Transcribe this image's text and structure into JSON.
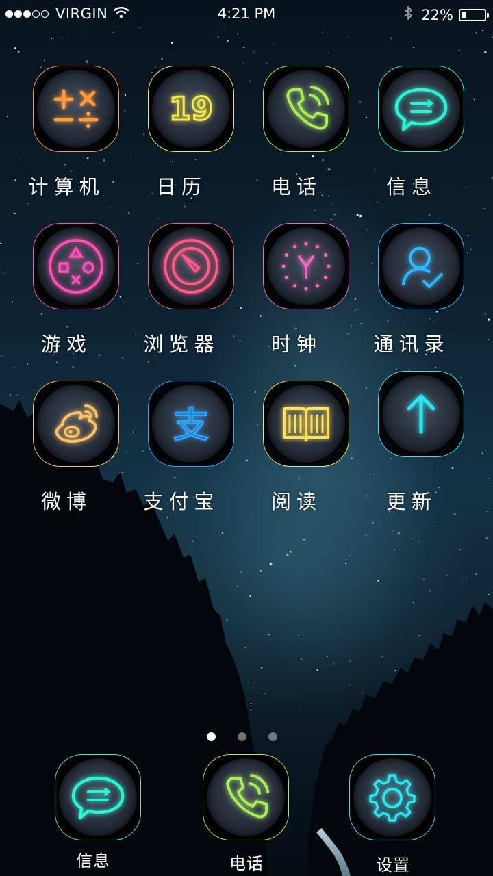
{
  "status_bar": {
    "carrier": "VIRGIN",
    "time": "4:21 PM",
    "battery_text": "22%",
    "battery_level": 0.22,
    "signal_bars": 5,
    "signal_filled": 3,
    "icons": [
      "wifi-icon",
      "bluetooth-icon",
      "battery-icon"
    ]
  },
  "apps": [
    {
      "label": "计算机",
      "icon": "calculator-icon",
      "color": "#ff9a3c"
    },
    {
      "label": "日历",
      "icon": "calendar-icon",
      "color": "#f6ea4a",
      "icon_text": "19"
    },
    {
      "label": "电话",
      "icon": "phone-icon",
      "color": "#a8ee5a"
    },
    {
      "label": "信息",
      "icon": "message-icon",
      "color": "#2ef2d4"
    },
    {
      "label": "游戏",
      "icon": "gamepad-icon",
      "color": "#ff4fb4"
    },
    {
      "label": "浏览器",
      "icon": "browser-compass-icon",
      "color": "#ff5a86"
    },
    {
      "label": "时钟",
      "icon": "clock-icon",
      "color": "#ee6ac0"
    },
    {
      "label": "通讯录",
      "icon": "contacts-icon",
      "color": "#2eb8ff"
    },
    {
      "label": "微博",
      "icon": "weibo-icon",
      "color": "#ffc066"
    },
    {
      "label": "支付宝",
      "icon": "alipay-icon",
      "color": "#2ea6ff",
      "icon_text": "支"
    },
    {
      "label": "阅读",
      "icon": "book-icon",
      "color": "#ffe25a"
    },
    {
      "label": "更新",
      "icon": "update-arrow-icon",
      "color": "#2ee6f0"
    }
  ],
  "page_indicator": {
    "count": 3,
    "active": 0
  },
  "dock": [
    {
      "label": "信息",
      "icon": "message-icon",
      "color": "#2ef2d4"
    },
    {
      "label": "电话",
      "icon": "phone-icon",
      "color": "#a8ee5a"
    },
    {
      "label": "设置",
      "icon": "gear-icon",
      "color": "#2ee6f0"
    }
  ]
}
